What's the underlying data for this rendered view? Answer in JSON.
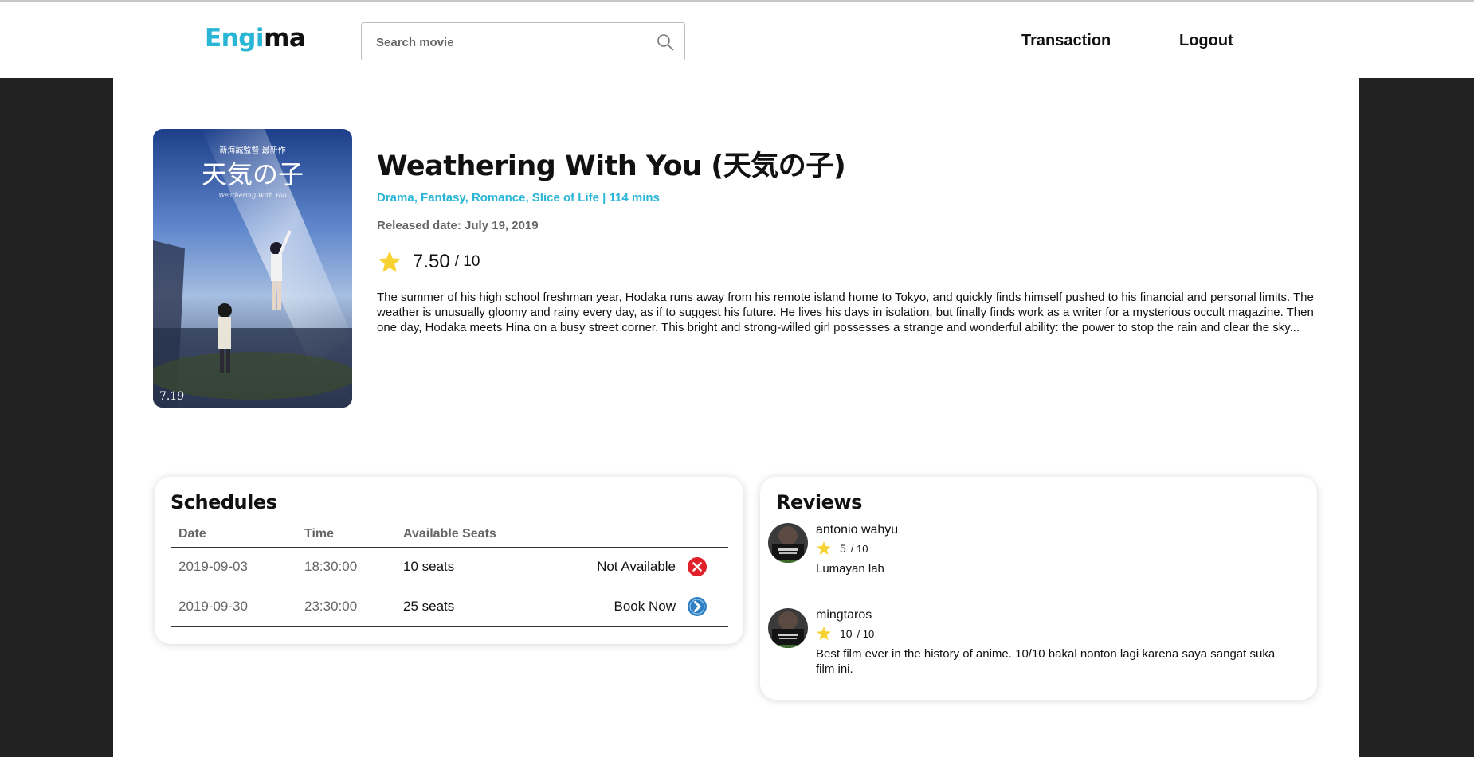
{
  "header": {
    "logo_part1": "Engi",
    "logo_part2": "ma",
    "search_placeholder": "Search movie",
    "nav": [
      "Transaction",
      "Logout"
    ]
  },
  "movie": {
    "title": "Weathering With You (天気の子)",
    "genres_duration": "Drama, Fantasy, Romance, Slice of Life | 114 mins",
    "released": "Released date: July 19, 2019",
    "rating": "7.50",
    "rating_max": "/ 10",
    "synopsis": "The summer of his high school freshman year, Hodaka runs away from his remote island home to Tokyo, and quickly finds himself pushed to his financial and personal limits. The weather is unusually gloomy and rainy every day, as if to suggest his future. He lives his days in isolation, but finally finds work as a writer for a mysterious occult magazine. Then one day, Hodaka meets Hina on a busy street corner. This bright and strong-willed girl possesses a strange and wonderful ability: the power to stop the rain and clear the sky...",
    "poster": {
      "credit_line": "新海誠監督 最新作",
      "title_jp": "天気の子",
      "title_en": "Weathering With You",
      "date": "7.19"
    }
  },
  "schedules": {
    "title": "Schedules",
    "columns": [
      "Date",
      "Time",
      "Available Seats"
    ],
    "rows": [
      {
        "date": "2019-09-03",
        "time": "18:30:00",
        "seats": "10 seats",
        "status": "Not Available"
      },
      {
        "date": "2019-09-30",
        "time": "23:30:00",
        "seats": "25 seats",
        "status": "Book Now"
      }
    ]
  },
  "reviews": {
    "title": "Reviews",
    "items": [
      {
        "name": "antonio wahyu",
        "score": "5",
        "max": "/ 10",
        "text": "Lumayan lah"
      },
      {
        "name": "mingtaros",
        "score": "10",
        "max": "/ 10",
        "text": "Best film ever in the history of anime. 10/10 bakal nonton lagi karena saya sangat suka film ini."
      }
    ]
  },
  "colors": {
    "accent": "#29b6d6",
    "danger": "#e0212a",
    "star": "#f7d230",
    "backdrop": "#222222"
  }
}
